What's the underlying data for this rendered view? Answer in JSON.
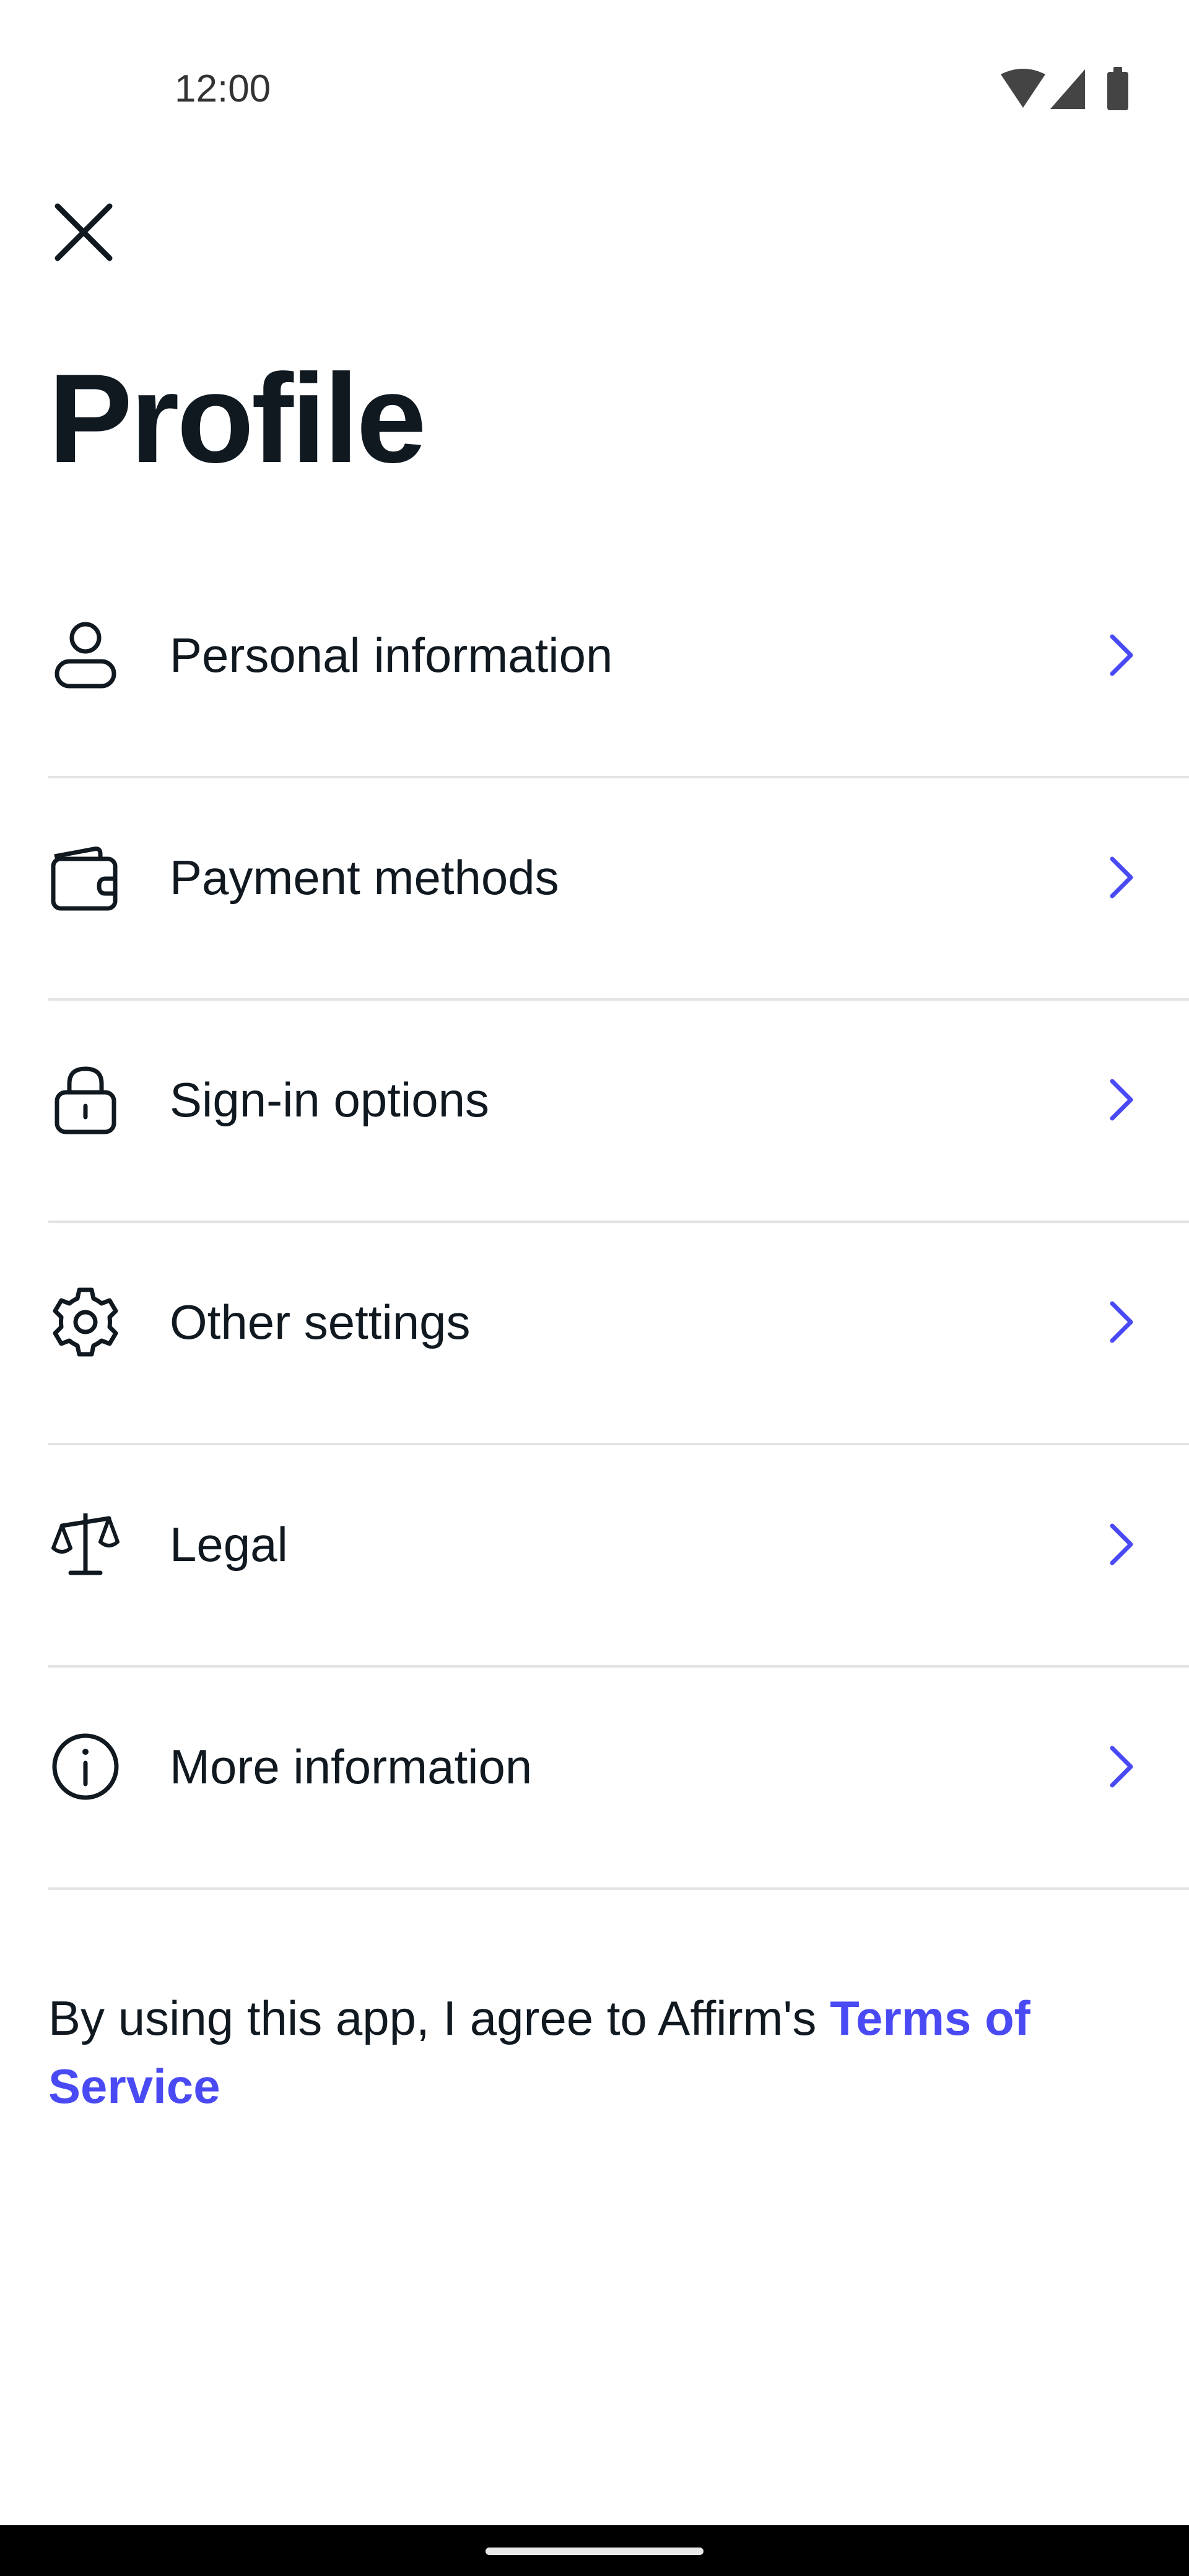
{
  "status_bar": {
    "time": "12:00",
    "icons": [
      "wifi-icon",
      "cellular-signal-icon",
      "battery-icon"
    ]
  },
  "header": {
    "close_icon": "close-icon",
    "title": "Profile"
  },
  "menu": {
    "items": [
      {
        "label": "Personal information",
        "icon": "person-icon"
      },
      {
        "label": "Payment methods",
        "icon": "wallet-icon"
      },
      {
        "label": "Sign-in options",
        "icon": "lock-icon"
      },
      {
        "label": "Other settings",
        "icon": "gear-icon"
      },
      {
        "label": "Legal",
        "icon": "scales-icon"
      },
      {
        "label": "More information",
        "icon": "info-icon"
      }
    ],
    "chevron_icon": "chevron-right-icon"
  },
  "footer": {
    "terms_prefix": "By using this app, I agree to Affirm's ",
    "terms_link": "Terms of Service"
  },
  "colors": {
    "text": "#101820",
    "accent": "#4a4af4",
    "divider": "#e3e3e6",
    "background": "#ffffff",
    "nav_bar": "#000000"
  }
}
